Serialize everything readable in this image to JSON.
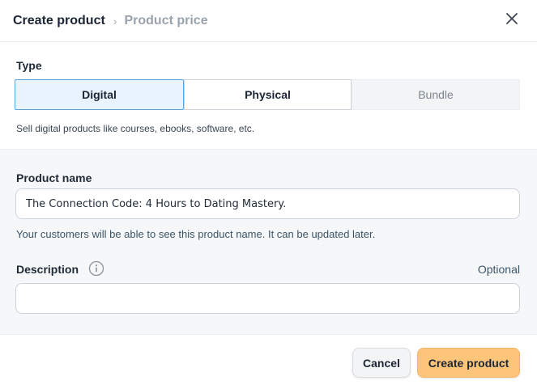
{
  "header": {
    "current_step": "Create product",
    "separator": "›",
    "next_step": "Product price",
    "close_icon": "close-icon"
  },
  "type": {
    "label": "Type",
    "options": [
      "Digital",
      "Physical",
      "Bundle"
    ],
    "selected": "Digital",
    "disabled": [
      "Bundle"
    ],
    "hint": "Sell digital products like courses, ebooks, software, etc."
  },
  "form": {
    "product_name": {
      "label": "Product name",
      "value": "The Connection Code: 4 Hours to Dating Mastery.",
      "help": "Your customers will be able to see this product name. It can be updated later."
    },
    "description": {
      "label": "Description",
      "info_icon": "info-icon",
      "optional": "Optional",
      "value": ""
    }
  },
  "footer": {
    "cancel_label": "Cancel",
    "create_label": "Create product"
  },
  "colors": {
    "selected_bg": "#e8f3fd",
    "selected_border": "#5fa3dc",
    "primary_button": "#fcc57a",
    "section_bg": "#f6f7f8"
  }
}
